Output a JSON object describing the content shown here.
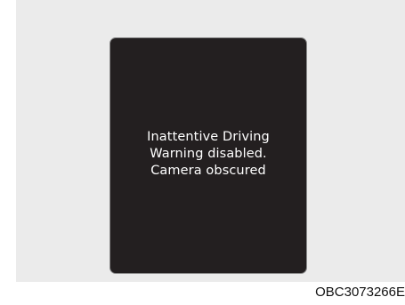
{
  "display": {
    "message_lines": [
      "Inattentive Driving",
      "Warning disabled.",
      "Camera obscured"
    ]
  },
  "figure": {
    "code": "OBC3073266E"
  },
  "colors": {
    "background_panel": "#ebebeb",
    "screen": "#231f20",
    "text": "#ffffff"
  }
}
